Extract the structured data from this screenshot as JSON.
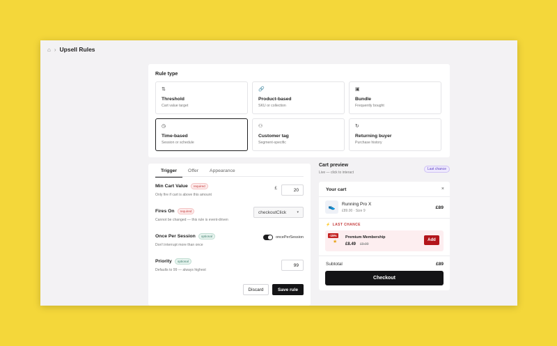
{
  "breadcrumb": {
    "home_icon": "home-icon",
    "separator": "›",
    "current": "Upsell Rules"
  },
  "rule_type": {
    "title": "Rule type",
    "options": [
      {
        "icon": "⇅",
        "icon_name": "sort-arrows-icon",
        "title": "Threshold",
        "subtitle": "Cart value target",
        "selected": false
      },
      {
        "icon": "🔗",
        "icon_name": "link-icon",
        "title": "Product-based",
        "subtitle": "SKU or collection",
        "selected": false
      },
      {
        "icon": "▣",
        "icon_name": "bundle-icon",
        "title": "Bundle",
        "subtitle": "Frequently bought",
        "selected": false
      },
      {
        "icon": "◷",
        "icon_name": "clock-icon",
        "title": "Time-based",
        "subtitle": "Session or schedule",
        "selected": true
      },
      {
        "icon": "⚇",
        "icon_name": "user-tag-icon",
        "title": "Customer tag",
        "subtitle": "Segment-specific",
        "selected": false
      },
      {
        "icon": "↻",
        "icon_name": "repeat-icon",
        "title": "Returning buyer",
        "subtitle": "Purchase history",
        "selected": false
      }
    ]
  },
  "tabs": [
    "Trigger",
    "Offer",
    "Appearance"
  ],
  "form": {
    "min_cart": {
      "label": "Min Cart Value",
      "badge": "required",
      "help": "Only fire if cart is above this amount",
      "currency": "£",
      "value": "20"
    },
    "fires_on": {
      "label": "Fires On",
      "badge": "required",
      "help": "Cannot be changed — this rule is event-driven",
      "value": "checkoutClick"
    },
    "once_per_session": {
      "label": "Once Per Session",
      "badge": "optional",
      "help": "Don't interrupt more than once",
      "toggle_label": "oncePerSession",
      "toggle_on": true
    },
    "priority": {
      "label": "Priority",
      "badge": "optional",
      "help": "Defaults to 99 — always highest",
      "value": "99"
    },
    "discard": "Discard",
    "save": "Save rule"
  },
  "preview": {
    "title": "Cart preview",
    "subtitle": "Live — click to interact",
    "badge": "Last chance"
  },
  "cart": {
    "title": "Your cart",
    "close": "×",
    "item": {
      "name": "Running Pro X",
      "sub": "£89.00 · Size 9",
      "price": "£89",
      "icon": "👟"
    },
    "last_chance": "LAST CHANCE",
    "offer": {
      "pct": "-15%",
      "name": "Premium Membership",
      "price": "£8.49",
      "old_price": "£9.99",
      "add": "Add"
    },
    "subtotal_label": "Subtotal",
    "subtotal_value": "£89",
    "checkout": "Checkout"
  },
  "colors": {
    "background": "#f4d73a",
    "accent_dark": "#141416",
    "danger": "#b3161c"
  }
}
